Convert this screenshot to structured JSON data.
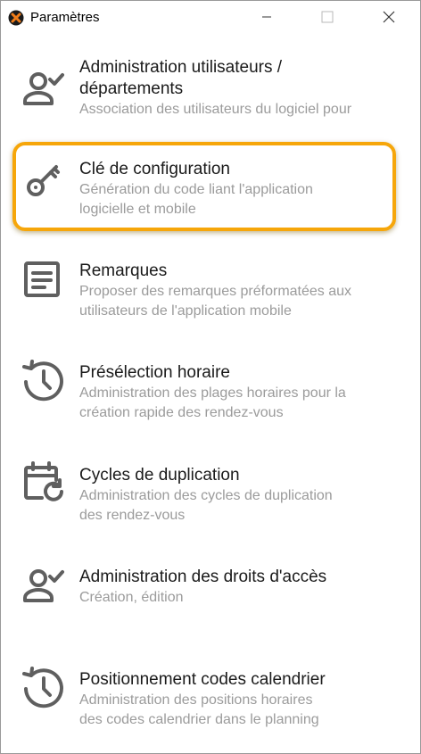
{
  "window": {
    "title": "Paramètres",
    "icon": "app-logo-icon",
    "controls": {
      "minimize": "minimize-icon",
      "maximize": "maximize-icon",
      "close": "close-icon"
    }
  },
  "items": [
    {
      "icon": "user-check-icon",
      "title": "Administration utilisateurs /\ndépartements",
      "description": "Association des utilisateurs du logiciel pour"
    },
    {
      "icon": "key-icon",
      "title": "Clé de configuration",
      "description": "Génération du code liant l'application\nlogicielle et mobile",
      "highlighted": true
    },
    {
      "icon": "document-icon",
      "title": "Remarques",
      "description": "Proposer des remarques préformatées aux\nutilisateurs de l'application mobile"
    },
    {
      "icon": "clock-history-icon",
      "title": "Présélection horaire",
      "description": "Administration des plages horaires pour la\ncréation rapide des rendez-vous"
    },
    {
      "icon": "calendar-refresh-icon",
      "title": "Cycles de duplication",
      "description": "Administration des cycles de duplication\ndes rendez-vous"
    },
    {
      "icon": "user-check-icon",
      "title": "Administration des droits d'accès",
      "description": "Création, édition"
    },
    {
      "icon": "clock-history-icon",
      "title": "Positionnement codes calendrier",
      "description": "Administration des positions horaires\ndes codes calendrier dans le planning"
    }
  ],
  "colors": {
    "highlight": "#f6a60a",
    "icon": "#5f5f5f",
    "title": "#1a1a1a",
    "description": "#9b9b9b"
  }
}
